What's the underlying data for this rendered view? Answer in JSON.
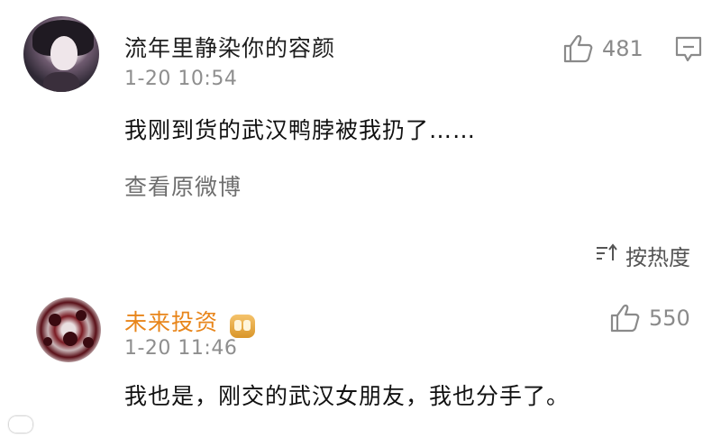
{
  "comment1": {
    "username": "流年里静染你的容颜",
    "time": "1-20 10:54",
    "content": "我刚到货的武汉鸭脖被我扔了……",
    "view_original": "查看原微博",
    "like_count": "481"
  },
  "sort": {
    "label": "按热度"
  },
  "comment2": {
    "username": "未来投资",
    "time": "1-20 11:46",
    "content": "我也是，刚交的武汉女朋友，我也分手了。",
    "like_count": "550"
  },
  "colors": {
    "username_highlight": "#e8851a",
    "meta_gray": "#8e8e8e"
  },
  "icons": [
    "thumbs-up-icon",
    "comment-icon",
    "sort-icon",
    "vip-badge-icon"
  ]
}
